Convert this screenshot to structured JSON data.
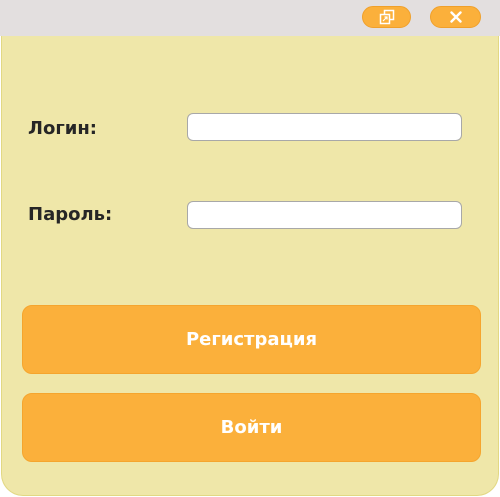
{
  "window": {
    "restore_icon": "restore-window-icon",
    "close_icon": "close-icon",
    "colors": {
      "titlebar": "#e3dfdf",
      "panel": "#efe7a9",
      "accent": "#fbb03b"
    }
  },
  "form": {
    "login_label": "Логин:",
    "login_value": "",
    "password_label": "Пароль:",
    "password_value": "",
    "register_button": "Регистрация",
    "login_button": "Войти"
  }
}
